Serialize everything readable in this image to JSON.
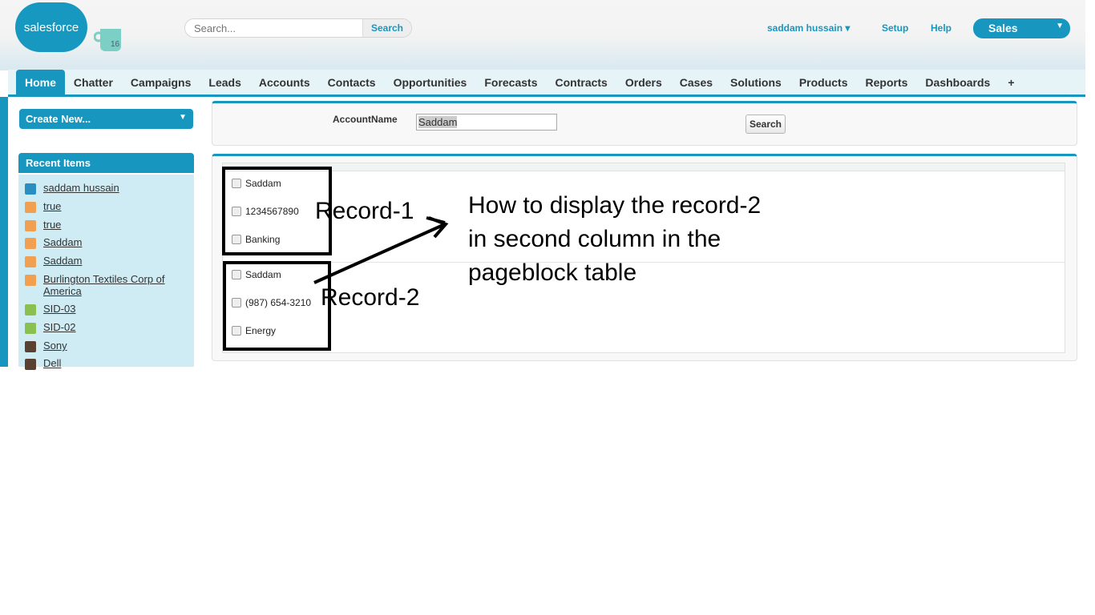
{
  "header": {
    "logo": "salesforce",
    "mug_label": "16",
    "search_placeholder": "Search...",
    "search_button": "Search",
    "user": "saddam hussain",
    "setup": "Setup",
    "help": "Help",
    "app": "Sales"
  },
  "tabs": [
    "Home",
    "Chatter",
    "Campaigns",
    "Leads",
    "Accounts",
    "Contacts",
    "Opportunities",
    "Forecasts",
    "Contracts",
    "Orders",
    "Cases",
    "Solutions",
    "Products",
    "Reports",
    "Dashboards",
    "+"
  ],
  "sidebar": {
    "create_new": "Create New...",
    "recent_title": "Recent Items",
    "recent": [
      {
        "label": "saddam hussain",
        "icon": "user-icon"
      },
      {
        "label": "true",
        "icon": "account-icon"
      },
      {
        "label": "true",
        "icon": "account-icon"
      },
      {
        "label": "Saddam",
        "icon": "account-icon"
      },
      {
        "label": "Saddam",
        "icon": "account-icon"
      },
      {
        "label": "Burlington Textiles Corp of America",
        "icon": "account-icon"
      },
      {
        "label": "SID-03",
        "icon": "custom-icon"
      },
      {
        "label": "SID-02",
        "icon": "custom-icon"
      },
      {
        "label": "Sony",
        "icon": "bottle-icon"
      },
      {
        "label": "Dell",
        "icon": "bottle-icon"
      }
    ]
  },
  "form": {
    "label": "AccountName",
    "value": "Saddam",
    "button": "Search"
  },
  "records": [
    [
      "Saddam",
      "1234567890",
      "Banking"
    ],
    [
      "Saddam",
      "(987) 654-3210",
      "Energy"
    ]
  ],
  "annotations": {
    "r1": "Record-1",
    "r2": "Record-2",
    "question": "How to display the record-2 in second column in the pageblock table"
  }
}
